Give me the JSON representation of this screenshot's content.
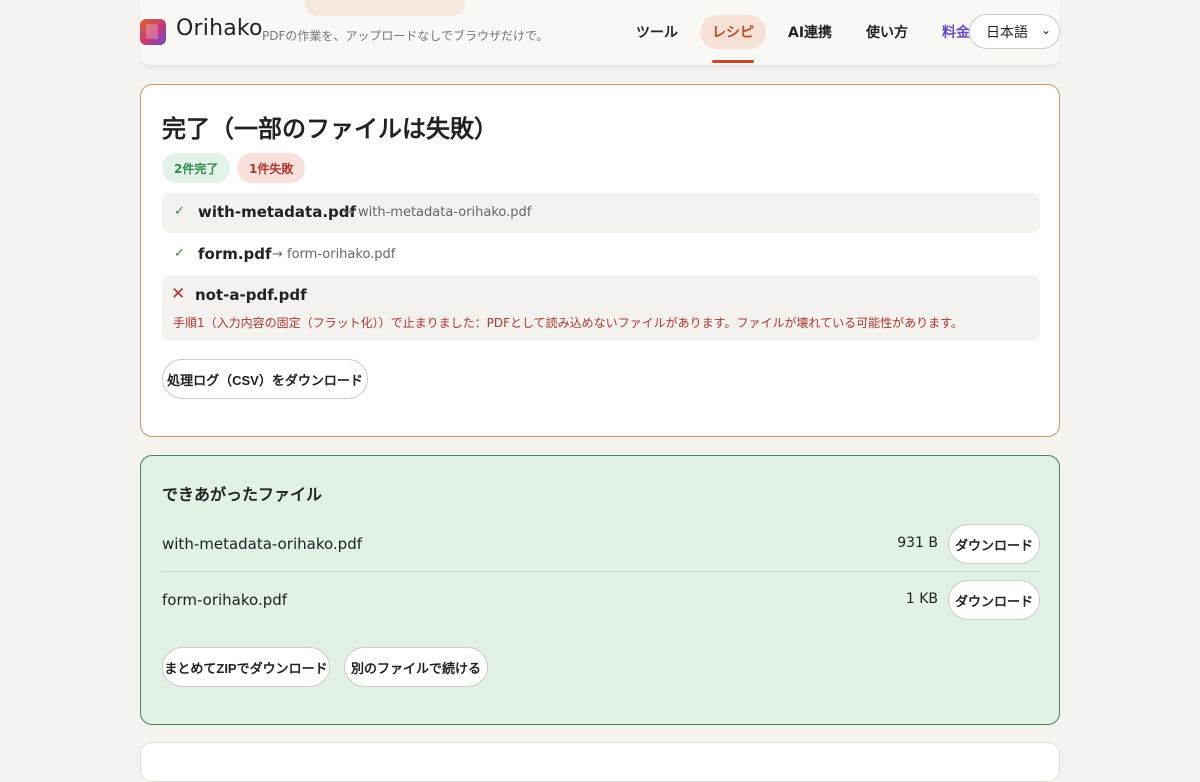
{
  "header": {
    "brand": "Orihako",
    "tagline": "PDFの作業を、アップロードなしでブラウザだけで。",
    "nav": [
      {
        "label": "ツール"
      },
      {
        "label": "レシピ",
        "active": true
      },
      {
        "label": "AI連携"
      },
      {
        "label": "使い方"
      },
      {
        "label": "料金"
      }
    ],
    "language": "日本語"
  },
  "result": {
    "title": "完了（一部のファイルは失敗）",
    "badge_success": "2件完了",
    "badge_failed": "1件失敗",
    "files": [
      {
        "status": "success",
        "name": "with-metadata.pdf",
        "output": "→ with-metadata-orihako.pdf"
      },
      {
        "status": "success",
        "name": "form.pdf",
        "output": "→ form-orihako.pdf"
      },
      {
        "status": "failed",
        "name": "not-a-pdf.pdf",
        "error": "手順1（入力内容の固定（フラット化））で止まりました：PDFとして読み込めないファイルがあります。ファイルが壊れている可能性があります。"
      }
    ],
    "log_button": "処理ログ（CSV）をダウンロード"
  },
  "output": {
    "title": "できあがったファイル",
    "files": [
      {
        "name": "with-metadata-orihako.pdf",
        "size": "931 B",
        "button": "ダウンロード"
      },
      {
        "name": "form-orihako.pdf",
        "size": "1 KB",
        "button": "ダウンロード"
      }
    ],
    "zip_button": "まとめてZIPでダウンロード",
    "continue_button": "別のファイルで続ける"
  },
  "colors": {
    "accent": "#c44a24",
    "success": "#2f8a4e",
    "error": "#b3362e",
    "pricing": "#6b4ad0",
    "result_border": "#c89a60",
    "output_bg": "#e2f1e6"
  },
  "icons": {
    "success_mark": "✓",
    "fail_mark": "✕",
    "select_chevron": "⌄"
  }
}
